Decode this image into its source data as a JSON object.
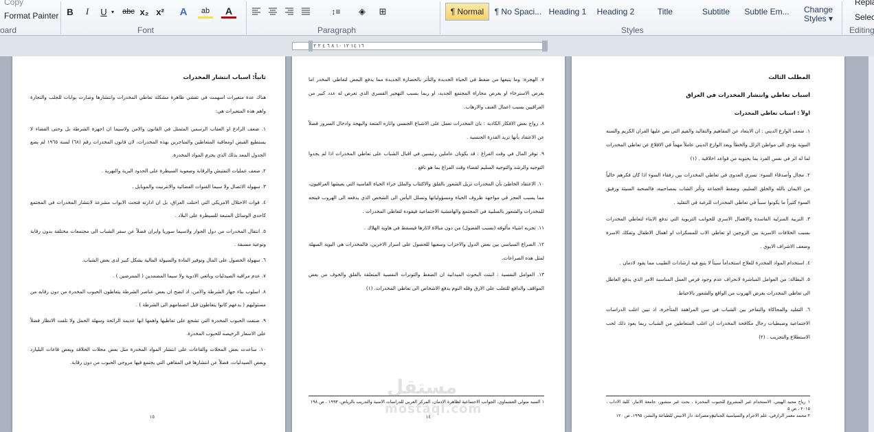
{
  "ribbon": {
    "clipboard": {
      "copy": "Copy",
      "format_painter": "Format Painter",
      "label": "oard"
    },
    "font": {
      "label": "Font",
      "bold": "B",
      "italic": "I",
      "underline": "U",
      "strikethrough": "abc",
      "subscript": "x₂",
      "superscript": "x²"
    },
    "paragraph": {
      "label": "Paragraph"
    },
    "styles": {
      "label": "Styles",
      "items": [
        "¶ Normal",
        "¶ No Spaci...",
        "Heading 1",
        "Heading 2",
        "Title",
        "Subtitle",
        "Subtle Em..."
      ],
      "change_styles": "Change Styles ▾"
    },
    "editing": {
      "label": "Editing",
      "replace": "Repla",
      "select": "Selec"
    }
  },
  "ruler": {
    "marks": "١٦ ١٤ ١٢ ١٠ ٨ ٦ ٤ ٢ ٢"
  },
  "pages": {
    "right": {
      "h1": "المطلب الثالث",
      "h2": "اسباب تعاطي وانتشار المخدرات في العراق",
      "h3": "اولاً : اسباب تعاطي المخدرات",
      "items": [
        "١. ضعف الوازع الديني : ان الابتعاد عن المفاهيم والتقاليد والقيم التي نص عليها القران الكريم والسنه النبوية يؤدي الى مواطن الزلل والخطأ ويعد الوازع الديني عاملاً مهماً في الاقلاع عن تعاطي المخدرات لما له اثر في نفس الفرد بما يحتويه من قواعد اخلاقية . (١)",
        "٢. مجال وأصدقاء السوء: تسري العدوى في تعاطي المخدرات بين رفقاء السوء اذا كان فكرهم خالياً من الايمان بالله والخلق السليم، وضغط الجماعة وتأثر الشاب بمصاحبيه، فالصحبة السيئة ورفيق السوء كثيراً ما يكونوا سبباً في تعاطي المخدرات للرغبة في التقليد .",
        "٣. التربية المنزلية الفاسدة والاهمال الاسري للجوانب التربوية التي تدفع الابناء لتعاطي المخدرات بسبب الخلافات الاسرية بين الزوجين او تعاطي الاب للمسكرات او اهمال الاطفال وتفكك الاسرة وضعف الاشراف الابوي .",
        "٤. استخدام المواد المخدرة للعلاج استخداماً سيئاً لا يتبع فيه ارشادات الطبيب مما يقود لادمان .",
        "٥. البطالة: من العوامل المباشرة لانحراف عدم وجود فرص العمل المناسبة الامر الذي يدفع العاطل الى تعاطي المخدرات بغرض الهروب من الواقع والشعور بالاحباط.",
        "٦. التقليد والمحاكاة والتفاخر بين الشباب في سن المراهقة المتأخرة، اذ تبين اغلب الدراسات الاجتماعية وضبطيات رجال مكافحة المخدرات ان اغلب المتعاطين من الشباب ربما يعود ذلك لحب الاستطلاع والتجريب . (٢)"
      ],
      "footnotes": [
        "١ رياح مجيد الهيتي، الاستخدام غير المشروع للحبوب المخدرة ، بحث غير منشور، جامعة الانبار، كلية الاداب ، ٢٠١٥ ، ص ٥",
        "٢ محمد معمر الرازقي، علم الاجرام والسياسية الجنائية، مصراتة، دار الانيس للطباعة والنشر، ١٩٩٥، ص ١٢٠"
      ],
      "page_number": "١٣"
    },
    "middle": {
      "items": [
        "٧. الهجرة: وما يتبعها من ضغط في الحياة الجديدة والتأثر بالحضارة الجديدة مما يدفع البعض لتعاطي المخدر اما بغرض الاسترخاء او بغرض مجاراة المجتمع الجديد، او ربما بسبب التهجير القسري الذي تعرض له عدد كبير من العراقيين بسبب اعمال العنف والارهاب.",
        "٨. رواج بعض الافكار الكاذبة : بان المخدرات تعمل على الاشباع الجنسي واثاره المتعة والبهجة وادخال السرور فضلاً عن الاعتقاد بأنها تزيد القدرة الجنسية .",
        "٩. توفر المال في وقت الفراغ : قد يكونان عاملين رئيسين في اقبال الشباب على تعاطي المخدرات اذا لم يجدوا التوجيه والرشد والتوجيه السليم لقضاء وقت الفراغ بما هو نافع .",
        "١٠. الاعتقاد الخاطئ بأن المخدرات تزيل الشعور بالقلق والاكتئاب والملل جراء الحياة القاسية التي يعيشها العراقيون، مما يسبب العجز في مواجهة ظروف الحياة ومسؤولياتها وتسلل اليأس الى الشخص الذي يدفعه الى الهروب فيتجه للمخدرات والشعور بالسلبية في المجتمع والهامشية الاجتماعية فيقوده لتعاطي المخدرات .",
        "١١. تجربه اشياء مألوفه (بسبب الفضول) من دون مبالاة لاثارها فيسقط في هاوية الهلاك .",
        "١٢. الصراع السياسي بين بعض الدول والاحزاب وسعيها للحصول على اسرار الاخرين، فالمخدرات هي البوية السهلة لمثل هذه الصراعات.",
        "١٣. العوامل النفسية : اثبتت البحوث الميدانية ان الضغط والتوترات النفسية المتعلقة بالقلق والخوف من بعض المواقف والدافع للتغلب على الارق وقله النوم يدفع الاشخاص الى تعاطي المخدرات. (١)"
      ],
      "footnotes": [
        "١ السيد متولي العشماوي، الجوانب الاجتماعية لظاهرة الادمان، المركز العربي للدراسات الامنية والتدريب بالرياض، ١٩٩٣ ، ص ١٩٨"
      ],
      "page_number": "١٤"
    },
    "left": {
      "h": "ثانياً: اسباب انتشار المخدرات",
      "intro": "هناك عدة متغيرات اسهمت في تفشي ظاهرة مشكلة تعاطي المخدرات وانتشارها وصارت بوابات للجلب والتجارة واهم هذه المتغيرات هي:",
      "items": [
        "١. ضعف الرادع او العقاب الرسمي المتمثل في القانون والامن ولاسيما ان اجهزة الشرطة بل وحتى القضاء لا يستطيع القبض اومعاقبة المتعاطين والمتاجرين بهذه المخدرات، لان قانون المخدرات رقم (٦٨) لسنة ١٩٦٥ لم يضع الجدول المعد بذلك الذي يحرم المواد المخدرة.",
        "٢. ضعف عمليات التفتيش والرقابة وصعوبة السيطرة على الحدود البرية والنهرية .",
        "٣. سهولة الاتصال ولا سيما القنوات الفضائية والانترنيت والموبايل .",
        "٤. قوات الاحتلال الامريكي التي احتلت العراق، بل ان ادارته فتحت الابواب مشرعة لانتشار المخدرات في المجتمع كاحدى الوسائل المتبعة للسيطرة على البلاد .",
        "٥. انتقال المخدرات من دول الجوار ولاسيما سوريا وايران فضلاً عن سفر الشباب الى مجتمعات مختلفة بدون رقابة وتوعية مسبقة .",
        "٦. سهولة الحصول على المال وتوفير المادة والسيولة المالية بشكل كبير لدى بعض الشباب.",
        "٧. عدم مراقبة الصيدليات وبائعي الادوية ولا سيما المضمدين ( الممرضين ) .",
        "٨. اسلوب بناء جهاز الشرطة والامن، اذ اتضح ان بعض عناصر الشرطة يتعاطون الحبوب المخدرة من دون رقابه من مسئوليهم ( بدعهم كانوا يتعاطون قبل انضمامهم الى الشرطة ) .",
        "٩. صنفت الحبوب المخدرة التي تشجع على تعاطيها واهمها انها عديمة الرائحة وسهلة الحمل ولا تلفت الانظار فضلاً على الاسعار الرخيصه للحبوب المخدرة.",
        "١٠. ساعدت بعض المحلات والقاعات على انتشار المواد المخدرة مثل بعض محلات الحلاقة وبعض قاعات البليارد وبعض الصيدليات، فضلاً عن انتشارها في المقاهي التي يجتمع فيها مروجي الحبوب من دون رقابة."
      ],
      "page_number": "١٥"
    }
  },
  "watermark": {
    "arabic": "مستقل",
    "latin": "mostaql.com"
  },
  "colors": {
    "highlight": "#f7d26a",
    "font_color": "#c00000",
    "ribbon_text": "#1f3a63"
  }
}
